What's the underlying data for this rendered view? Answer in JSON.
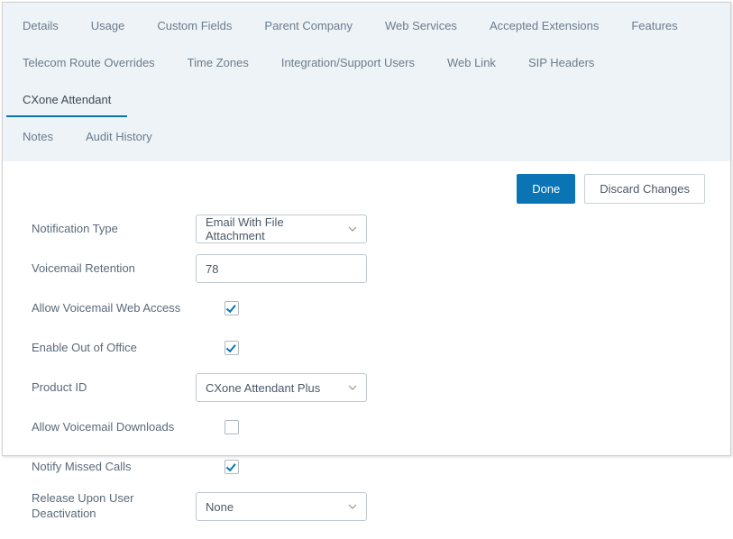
{
  "tabs": {
    "row1": [
      {
        "label": "Details",
        "active": false
      },
      {
        "label": "Usage",
        "active": false
      },
      {
        "label": "Custom Fields",
        "active": false
      },
      {
        "label": "Parent Company",
        "active": false
      },
      {
        "label": "Web Services",
        "active": false
      },
      {
        "label": "Accepted Extensions",
        "active": false
      },
      {
        "label": "Features",
        "active": false
      }
    ],
    "row2": [
      {
        "label": "Telecom Route Overrides",
        "active": false
      },
      {
        "label": "Time Zones",
        "active": false
      },
      {
        "label": "Integration/Support Users",
        "active": false
      },
      {
        "label": "Web Link",
        "active": false
      },
      {
        "label": "SIP Headers",
        "active": false
      },
      {
        "label": "CXone Attendant",
        "active": true
      }
    ],
    "row3": [
      {
        "label": "Notes",
        "active": false
      },
      {
        "label": "Audit History",
        "active": false
      }
    ]
  },
  "actions": {
    "done": "Done",
    "discard": "Discard Changes"
  },
  "form": {
    "notification_type": {
      "label": "Notification Type",
      "value": "Email With File Attachment"
    },
    "voicemail_retention": {
      "label": "Voicemail Retention",
      "value": "78"
    },
    "allow_web_access": {
      "label": "Allow Voicemail Web Access",
      "checked": true
    },
    "enable_ooo": {
      "label": "Enable Out of Office",
      "checked": true
    },
    "product_id": {
      "label": "Product ID",
      "value": "CXone Attendant Plus"
    },
    "allow_downloads": {
      "label": "Allow Voicemail Downloads",
      "checked": false
    },
    "notify_missed": {
      "label": "Notify Missed Calls",
      "checked": true
    },
    "release_deactivation": {
      "label": "Release Upon User Deactivation",
      "value": "None"
    }
  }
}
